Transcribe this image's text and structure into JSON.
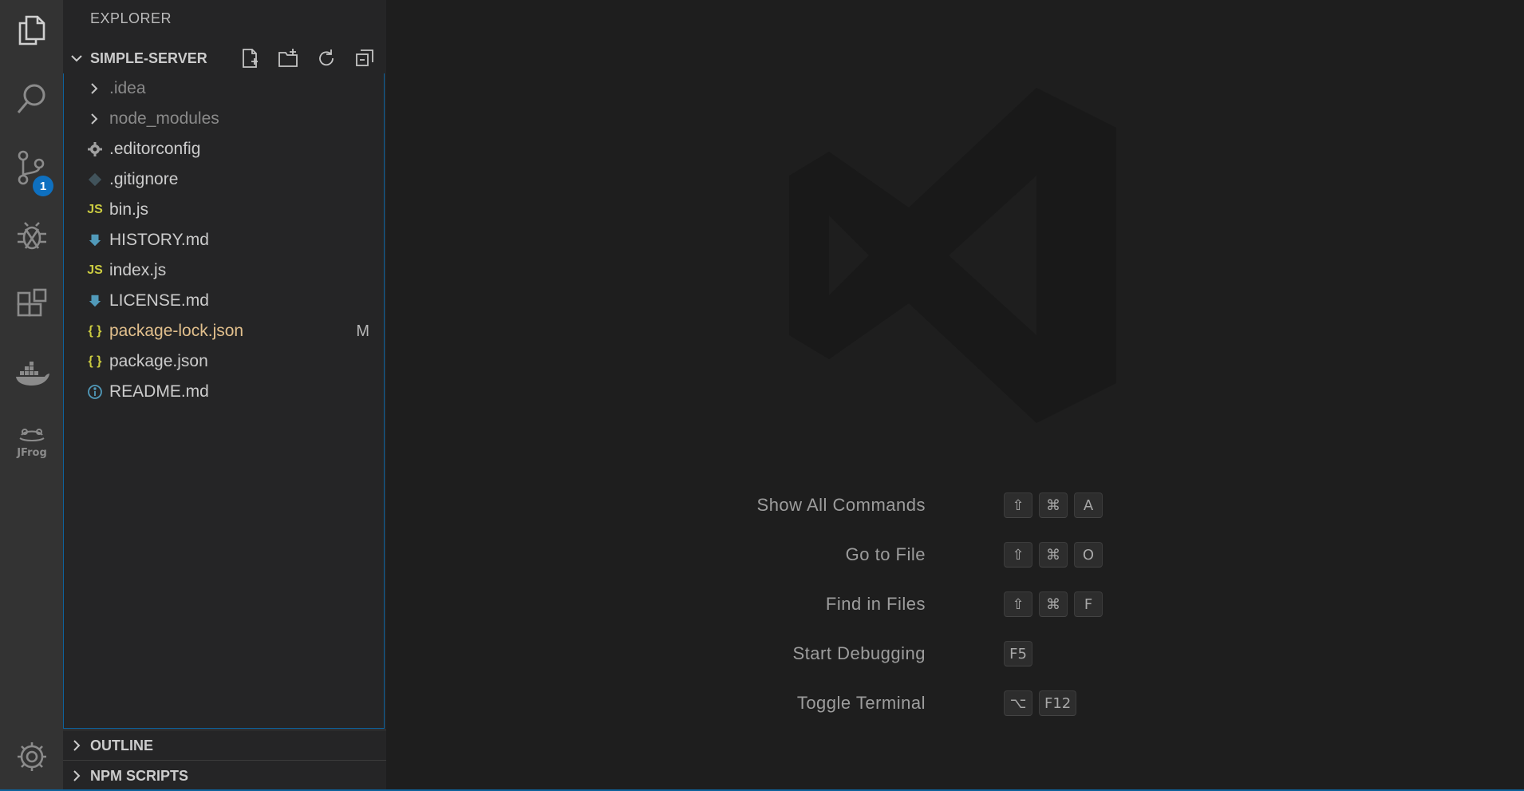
{
  "activity_bar": {
    "items": [
      {
        "name": "explorer-icon"
      },
      {
        "name": "search-icon"
      },
      {
        "name": "source-control-icon",
        "badge": "1"
      },
      {
        "name": "debug-icon"
      },
      {
        "name": "extensions-icon"
      },
      {
        "name": "docker-icon"
      },
      {
        "name": "jfrog-icon",
        "label": "JFrog"
      },
      {
        "name": "settings-gear-icon"
      }
    ]
  },
  "sidebar": {
    "title": "EXPLORER",
    "folder": {
      "name": "SIMPLE-SERVER",
      "toolbar": [
        "new-file-icon",
        "new-folder-icon",
        "refresh-icon",
        "collapse-all-icon"
      ]
    },
    "files": [
      {
        "name": ".idea",
        "type": "folder"
      },
      {
        "name": "node_modules",
        "type": "folder"
      },
      {
        "name": ".editorconfig",
        "icon": "gear"
      },
      {
        "name": ".gitignore",
        "icon": "git"
      },
      {
        "name": "bin.js",
        "icon": "JS"
      },
      {
        "name": "HISTORY.md",
        "icon": "markdown"
      },
      {
        "name": "index.js",
        "icon": "JS"
      },
      {
        "name": "LICENSE.md",
        "icon": "markdown"
      },
      {
        "name": "package-lock.json",
        "icon": "{ }",
        "status": "M"
      },
      {
        "name": "package.json",
        "icon": "{ }"
      },
      {
        "name": "README.md",
        "icon": "info"
      }
    ],
    "sections": [
      {
        "label": "OUTLINE"
      },
      {
        "label": "NPM SCRIPTS"
      }
    ]
  },
  "welcome": {
    "shortcuts": [
      {
        "label": "Show All Commands",
        "keys": [
          "⇧",
          "⌘",
          "A"
        ]
      },
      {
        "label": "Go to File",
        "keys": [
          "⇧",
          "⌘",
          "O"
        ]
      },
      {
        "label": "Find in Files",
        "keys": [
          "⇧",
          "⌘",
          "F"
        ]
      },
      {
        "label": "Start Debugging",
        "keys": [
          "F5"
        ]
      },
      {
        "label": "Toggle Terminal",
        "keys": [
          "⌥",
          "F12"
        ]
      }
    ]
  },
  "colors": {
    "accent": "#0e70c0",
    "modified": "#e2c08d",
    "js": "#cbcb41",
    "json": "#cbcb41",
    "markdown": "#519aba"
  }
}
